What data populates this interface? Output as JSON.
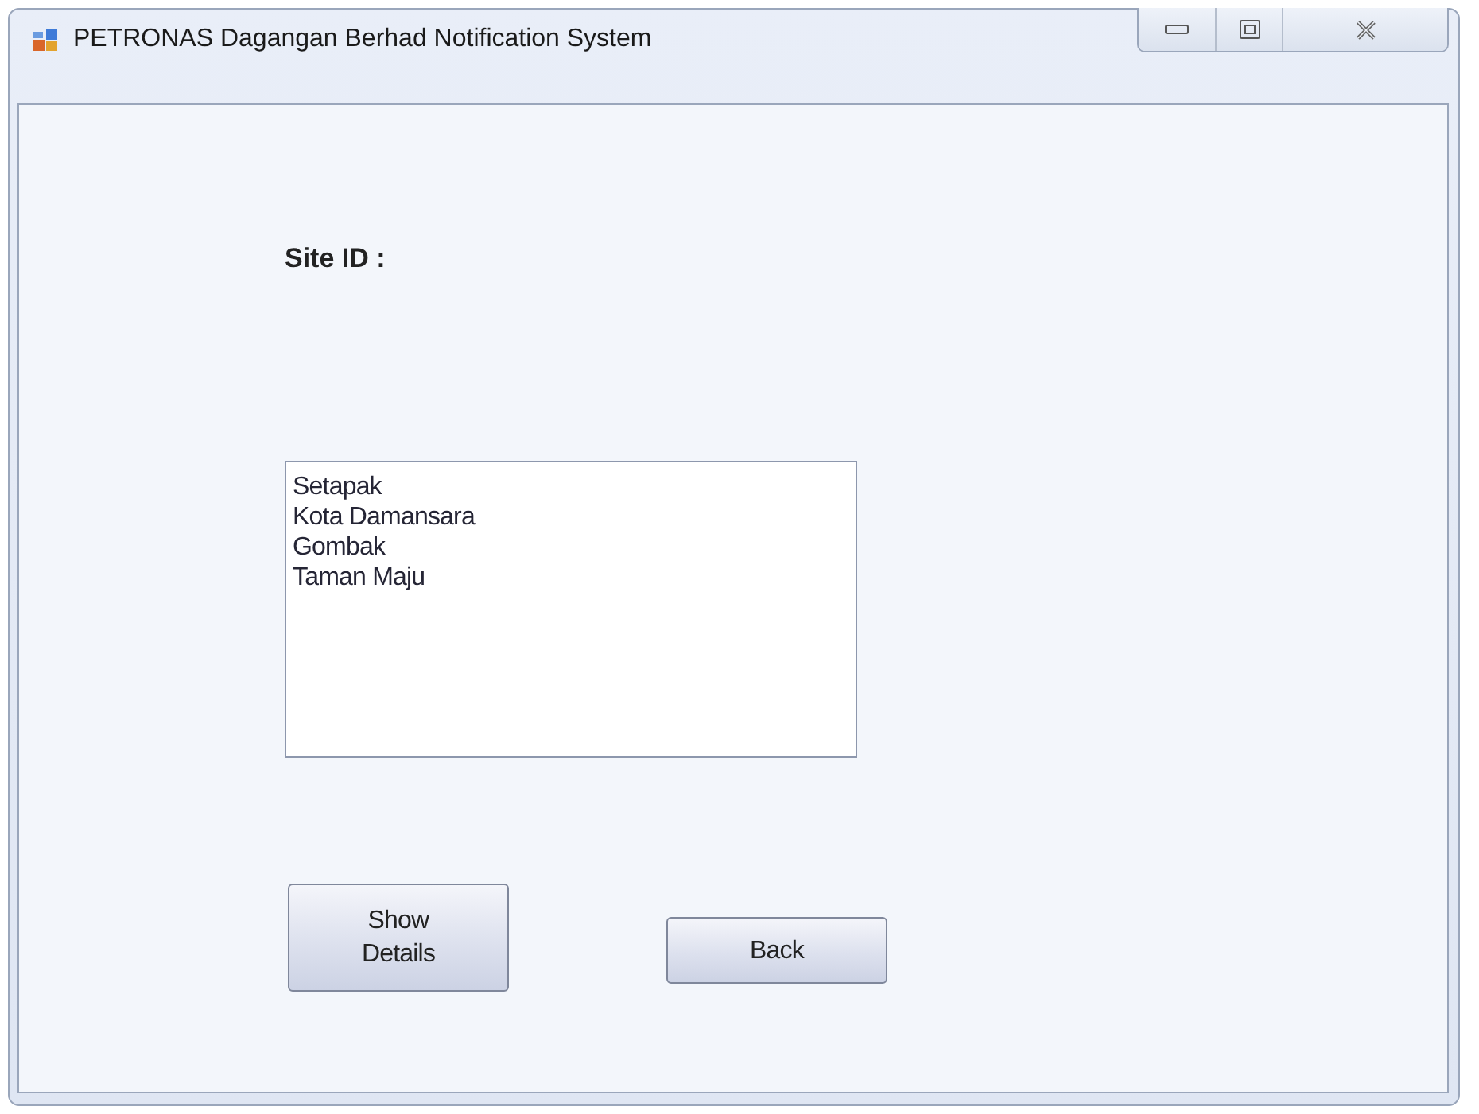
{
  "window": {
    "title": "PETRONAS Dagangan Berhad Notification System"
  },
  "site_id_label": "Site ID :",
  "site_list": [
    "Setapak",
    "Kota Damansara",
    "Gombak",
    "Taman Maju"
  ],
  "buttons": [
    {
      "label": "Show\nDetails",
      "kind": "tall"
    },
    {
      "label": "Back",
      "kind": "short"
    }
  ]
}
